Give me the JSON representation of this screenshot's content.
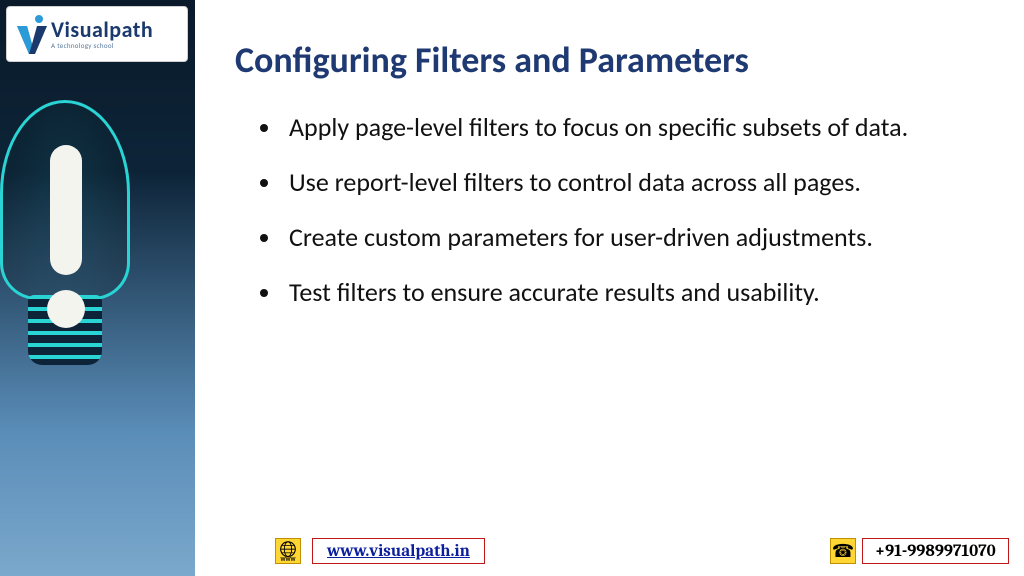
{
  "logo": {
    "main": "Visualpath",
    "sub": "A technology school"
  },
  "title": "Configuring Filters and Parameters",
  "bullets": [
    "Apply page-level filters to focus on specific subsets of data.",
    "Use report-level filters to control data across all pages.",
    "Create custom parameters for user-driven adjustments.",
    "Test filters to ensure accurate results and usability."
  ],
  "footer": {
    "url": "www.visualpath.in",
    "phone": "+91-9989971070"
  }
}
